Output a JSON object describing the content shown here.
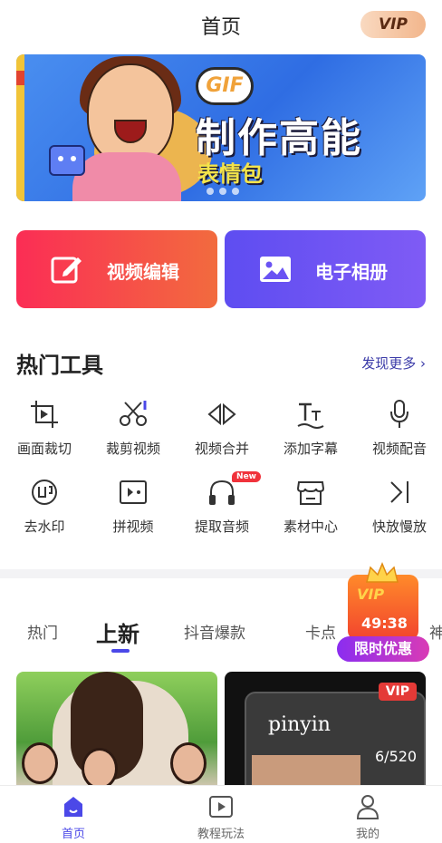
{
  "header": {
    "title": "首页",
    "vip_label": "VIP"
  },
  "banner": {
    "gif_badge": "GIF",
    "title": "制作高能",
    "subtitle": "表情包"
  },
  "actions": [
    {
      "label": "视频编辑",
      "icon": "edit-icon",
      "color": "#fb2d55"
    },
    {
      "label": "电子相册",
      "icon": "photo-icon",
      "color": "#5e4df1"
    }
  ],
  "hot_tools": {
    "title": "热门工具",
    "more_label": "发现更多",
    "items": [
      {
        "label": "画面裁切",
        "icon": "crop-icon"
      },
      {
        "label": "裁剪视频",
        "icon": "scissors-icon"
      },
      {
        "label": "视频合并",
        "icon": "merge-icon"
      },
      {
        "label": "添加字幕",
        "icon": "subtitle-icon"
      },
      {
        "label": "视频配音",
        "icon": "microphone-icon"
      },
      {
        "label": "去水印",
        "icon": "watermark-icon"
      },
      {
        "label": "拼视频",
        "icon": "collage-icon"
      },
      {
        "label": "提取音频",
        "icon": "headphone-icon",
        "badge": "New"
      },
      {
        "label": "素材中心",
        "icon": "store-icon"
      },
      {
        "label": "快放慢放",
        "icon": "speed-icon"
      }
    ]
  },
  "tabs": [
    {
      "label": "热门"
    },
    {
      "label": "上新"
    },
    {
      "label": "抖音爆款"
    },
    {
      "label": "卡点"
    },
    {
      "label": "神"
    }
  ],
  "promo": {
    "vip": "VIP",
    "countdown": "49:38",
    "label": "限时优惠"
  },
  "videos": [
    {
      "tag": ""
    },
    {
      "tag": "VIP",
      "text": "pinyin",
      "counter": "6/520"
    }
  ],
  "bottom_nav": [
    {
      "label": "首页",
      "icon": "home-icon"
    },
    {
      "label": "教程玩法",
      "icon": "video-play-icon"
    },
    {
      "label": "我的",
      "icon": "user-icon"
    }
  ],
  "colors": {
    "accent": "#4b48e8",
    "red": "#fb2d55",
    "orange": "#f26b3e",
    "purple": "#5e4df1"
  }
}
